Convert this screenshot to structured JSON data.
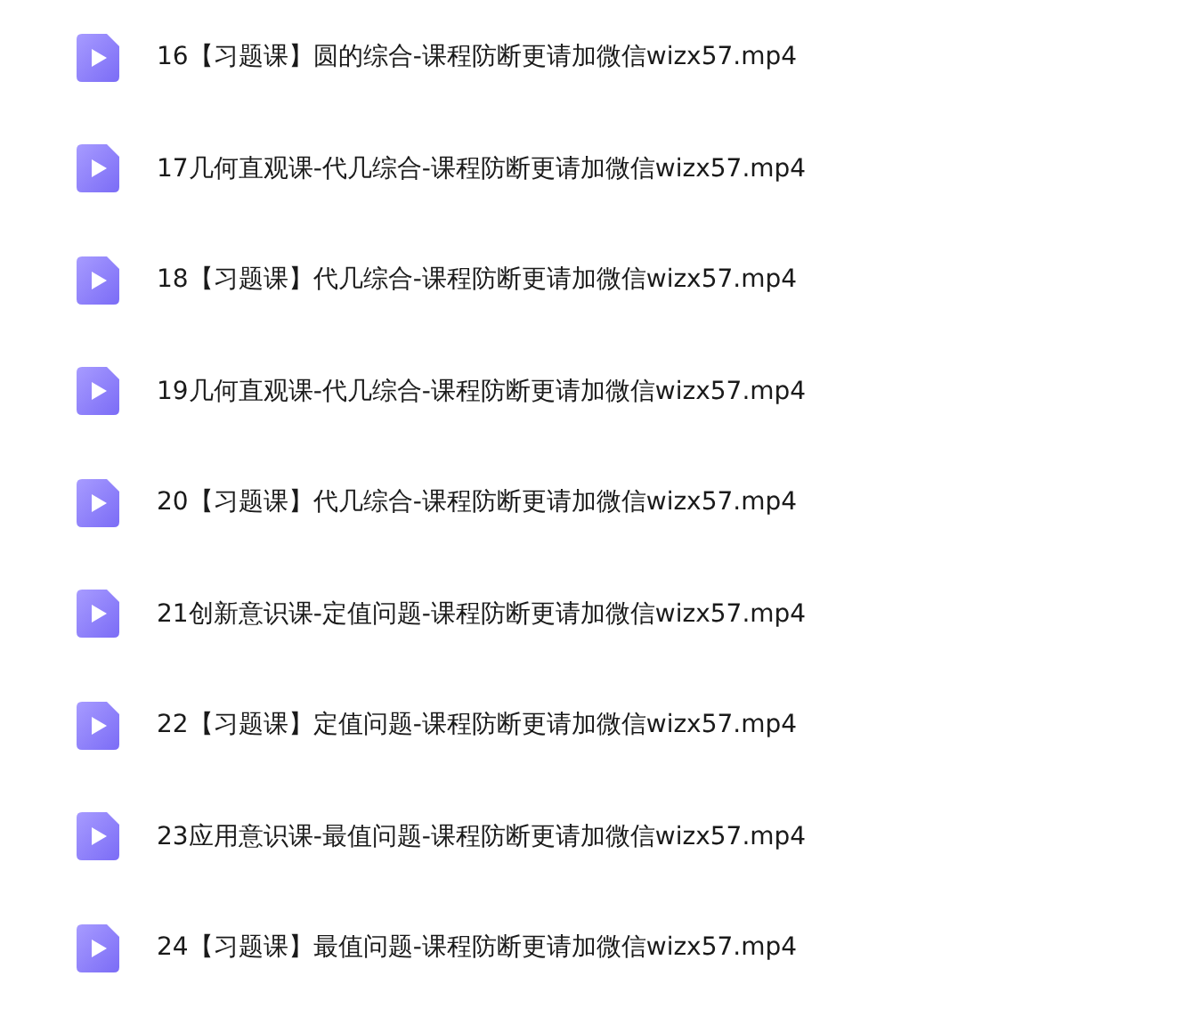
{
  "files": [
    {
      "name": "16【习题课】圆的综合-课程防断更请加微信wizx57.mp4"
    },
    {
      "name": "17几何直观课-代几综合-课程防断更请加微信wizx57.mp4"
    },
    {
      "name": "18【习题课】代几综合-课程防断更请加微信wizx57.mp4"
    },
    {
      "name": "19几何直观课-代几综合-课程防断更请加微信wizx57.mp4"
    },
    {
      "name": "20【习题课】代几综合-课程防断更请加微信wizx57.mp4"
    },
    {
      "name": "21创新意识课-定值问题-课程防断更请加微信wizx57.mp4"
    },
    {
      "name": "22【习题课】定值问题-课程防断更请加微信wizx57.mp4"
    },
    {
      "name": "23应用意识课-最值问题-课程防断更请加微信wizx57.mp4"
    },
    {
      "name": "24【习题课】最值问题-课程防断更请加微信wizx57.mp4"
    }
  ]
}
